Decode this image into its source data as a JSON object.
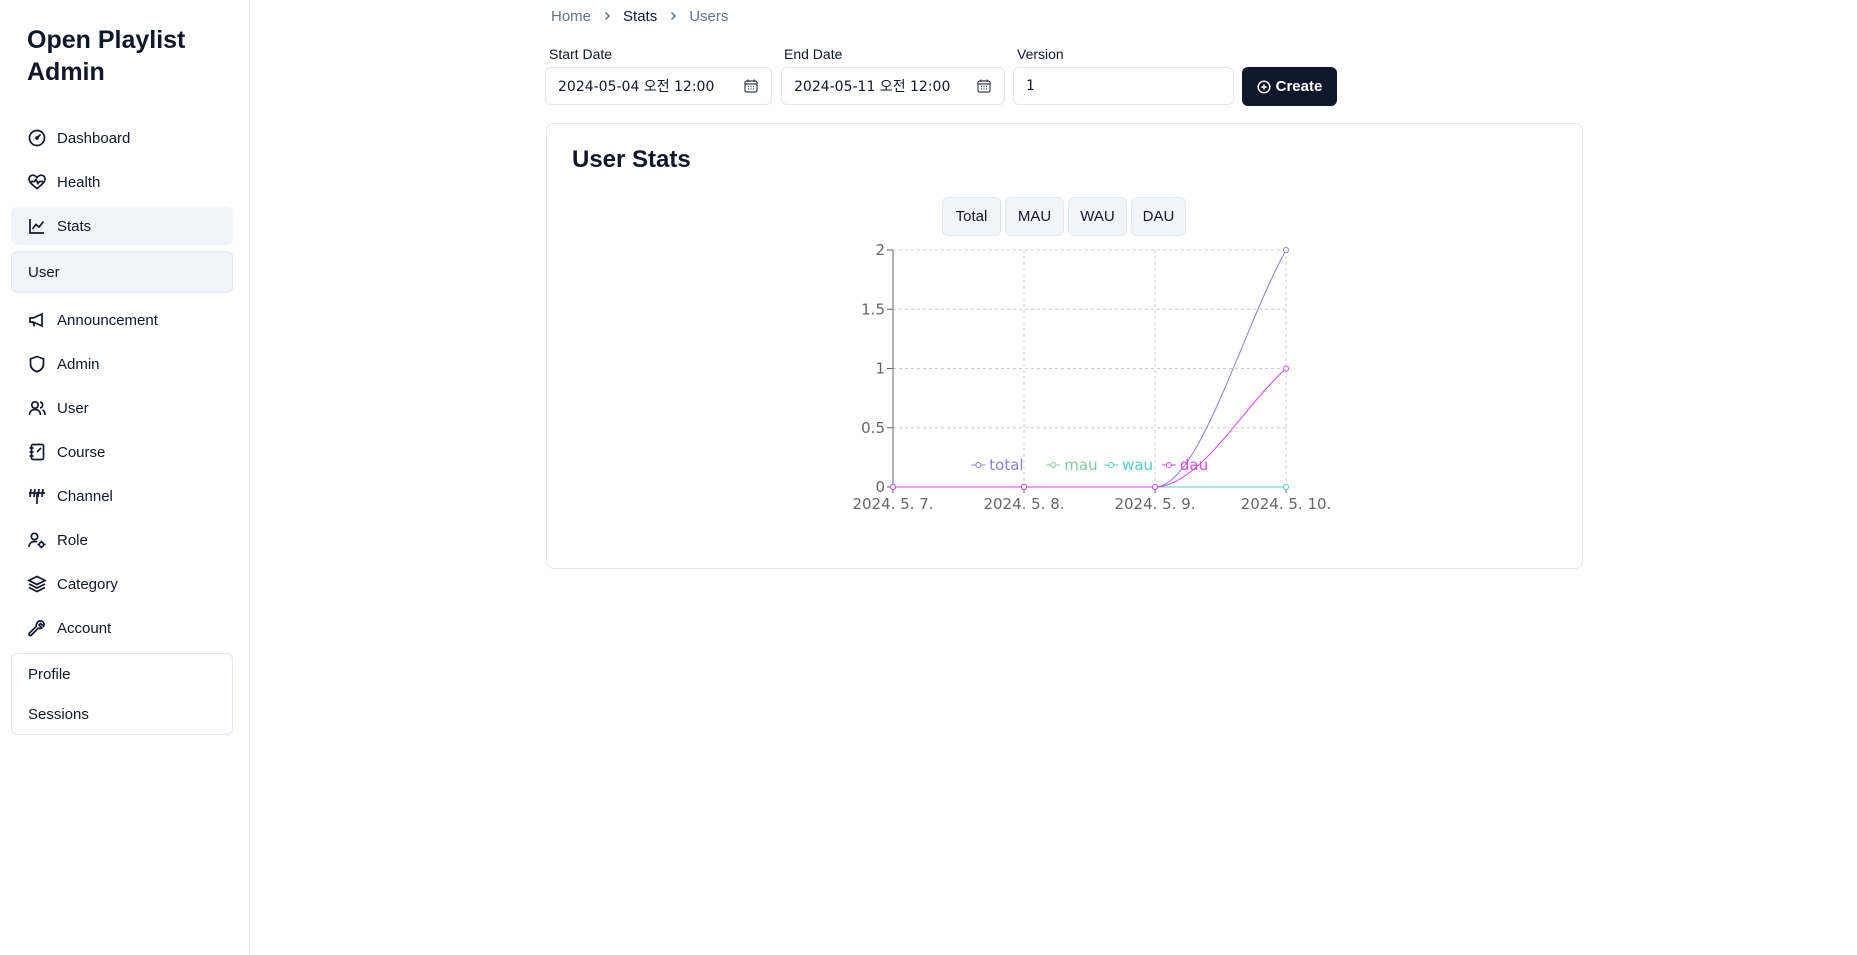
{
  "app": {
    "title": "Open Playlist Admin"
  },
  "sidebar": {
    "items": [
      {
        "label": "Dashboard",
        "icon": "dashboard-gauge-icon"
      },
      {
        "label": "Health",
        "icon": "heart-pulse-icon"
      },
      {
        "label": "Stats",
        "icon": "line-chart-icon",
        "active": true
      },
      {
        "label": "Announcement",
        "icon": "megaphone-icon"
      },
      {
        "label": "Admin",
        "icon": "shield-icon"
      },
      {
        "label": "User",
        "icon": "users-icon"
      },
      {
        "label": "Course",
        "icon": "notebook-icon"
      },
      {
        "label": "Channel",
        "icon": "antenna-icon"
      },
      {
        "label": "Role",
        "icon": "user-cog-icon"
      },
      {
        "label": "Category",
        "icon": "layers-icon"
      },
      {
        "label": "Account",
        "icon": "wrench-icon"
      }
    ],
    "stats_sub": [
      {
        "label": "User",
        "active": true
      }
    ],
    "account_sub": [
      {
        "label": "Profile"
      },
      {
        "label": "Sessions"
      }
    ]
  },
  "breadcrumb": {
    "items": [
      "Home",
      "Stats",
      "Users"
    ]
  },
  "filters": {
    "start_date": {
      "label": "Start Date",
      "value": "2024-05-04 오전 12:00"
    },
    "end_date": {
      "label": "End Date",
      "value": "2024-05-11 오전 12:00"
    },
    "version": {
      "label": "Version",
      "value": "1"
    },
    "create_label": "Create"
  },
  "card": {
    "title": "User Stats",
    "segments": [
      "Total",
      "MAU",
      "WAU",
      "DAU"
    ]
  },
  "colors": {
    "primary": "#0f172a",
    "total": "#8b7fd8",
    "mau": "#82ca9d",
    "wau": "#4fd1c5",
    "dau": "#d946ef"
  },
  "chart_data": {
    "type": "line",
    "x": [
      "2024. 5. 7.",
      "2024. 5. 8.",
      "2024. 5. 9.",
      "2024. 5. 10."
    ],
    "ylim": [
      0,
      2
    ],
    "yticks": [
      "0",
      "0.5",
      "1",
      "1.5",
      "2"
    ],
    "grid": true,
    "legend_position": "bottom",
    "series": [
      {
        "name": "total",
        "values": [
          0,
          0,
          0,
          2
        ]
      },
      {
        "name": "mau",
        "values": [
          0,
          0,
          0,
          0
        ]
      },
      {
        "name": "wau",
        "values": [
          0,
          0,
          0,
          0
        ]
      },
      {
        "name": "dau",
        "values": [
          0,
          0,
          0,
          1
        ]
      }
    ]
  }
}
